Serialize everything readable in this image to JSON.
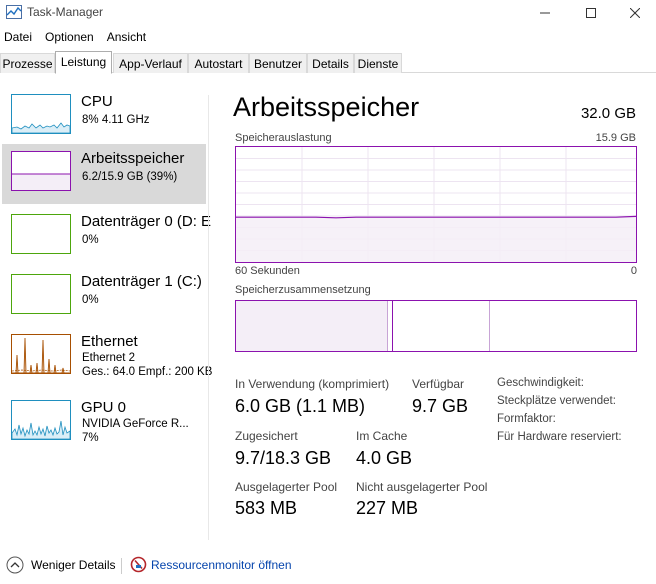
{
  "window": {
    "title": "Task-Manager"
  },
  "menu": [
    "Datei",
    "Optionen",
    "Ansicht"
  ],
  "tabs": [
    "Prozesse",
    "Leistung",
    "App-Verlauf",
    "Autostart",
    "Benutzer",
    "Details",
    "Dienste"
  ],
  "active_tab": "Leistung",
  "sidebar": {
    "items": [
      {
        "title": "CPU",
        "sub": "8%  4.11 GHz",
        "sub2": "",
        "color": "#1f8fbf"
      },
      {
        "title": "Arbeitsspeicher",
        "sub": "6.2/15.9 GB (39%)",
        "sub2": "",
        "color": "#8b12ae"
      },
      {
        "title": "Datenträger 0 (D: E",
        "sub": "0%",
        "sub2": "",
        "color": "#4da60c"
      },
      {
        "title": "Datenträger 1 (C:)",
        "sub": "0%",
        "sub2": "",
        "color": "#4da60c"
      },
      {
        "title": "Ethernet",
        "sub": "Ethernet 2",
        "sub2": "Ges.: 64.0  Empf.: 200 KB",
        "color": "#a74f01"
      },
      {
        "title": "GPU 0",
        "sub": "NVIDIA GeForce R...",
        "sub2": "7%",
        "color": "#1f8fbf"
      }
    ]
  },
  "main": {
    "title": "Arbeitsspeicher",
    "total": "32.0 GB",
    "usage_label": "Speicherauslastung",
    "usage_max": "15.9 GB",
    "time_left": "60 Sekunden",
    "time_right": "0",
    "composition_label": "Speicherzusammensetzung",
    "usage_fraction": 0.39,
    "stats": {
      "in_use_label": "In Verwendung (komprimiert)",
      "in_use_value": "6.0 GB (1.1 MB)",
      "available_label": "Verfügbar",
      "available_value": "9.7 GB",
      "committed_label": "Zugesichert",
      "committed_value": "9.7/18.3 GB",
      "cached_label": "Im Cache",
      "cached_value": "4.0 GB",
      "paged_label": "Ausgelagerter Pool",
      "paged_value": "583 MB",
      "nonpaged_label": "Nicht ausgelagerter Pool",
      "nonpaged_value": "227 MB"
    },
    "details": {
      "speed": "Geschwindigkeit:",
      "slots": "Steckplätze verwendet:",
      "form": "Formfaktor:",
      "reserved": "Für Hardware reserviert:"
    }
  },
  "footer": {
    "fewer_details": "Weniger Details",
    "resource_monitor": "Ressourcenmonitor öffnen"
  }
}
